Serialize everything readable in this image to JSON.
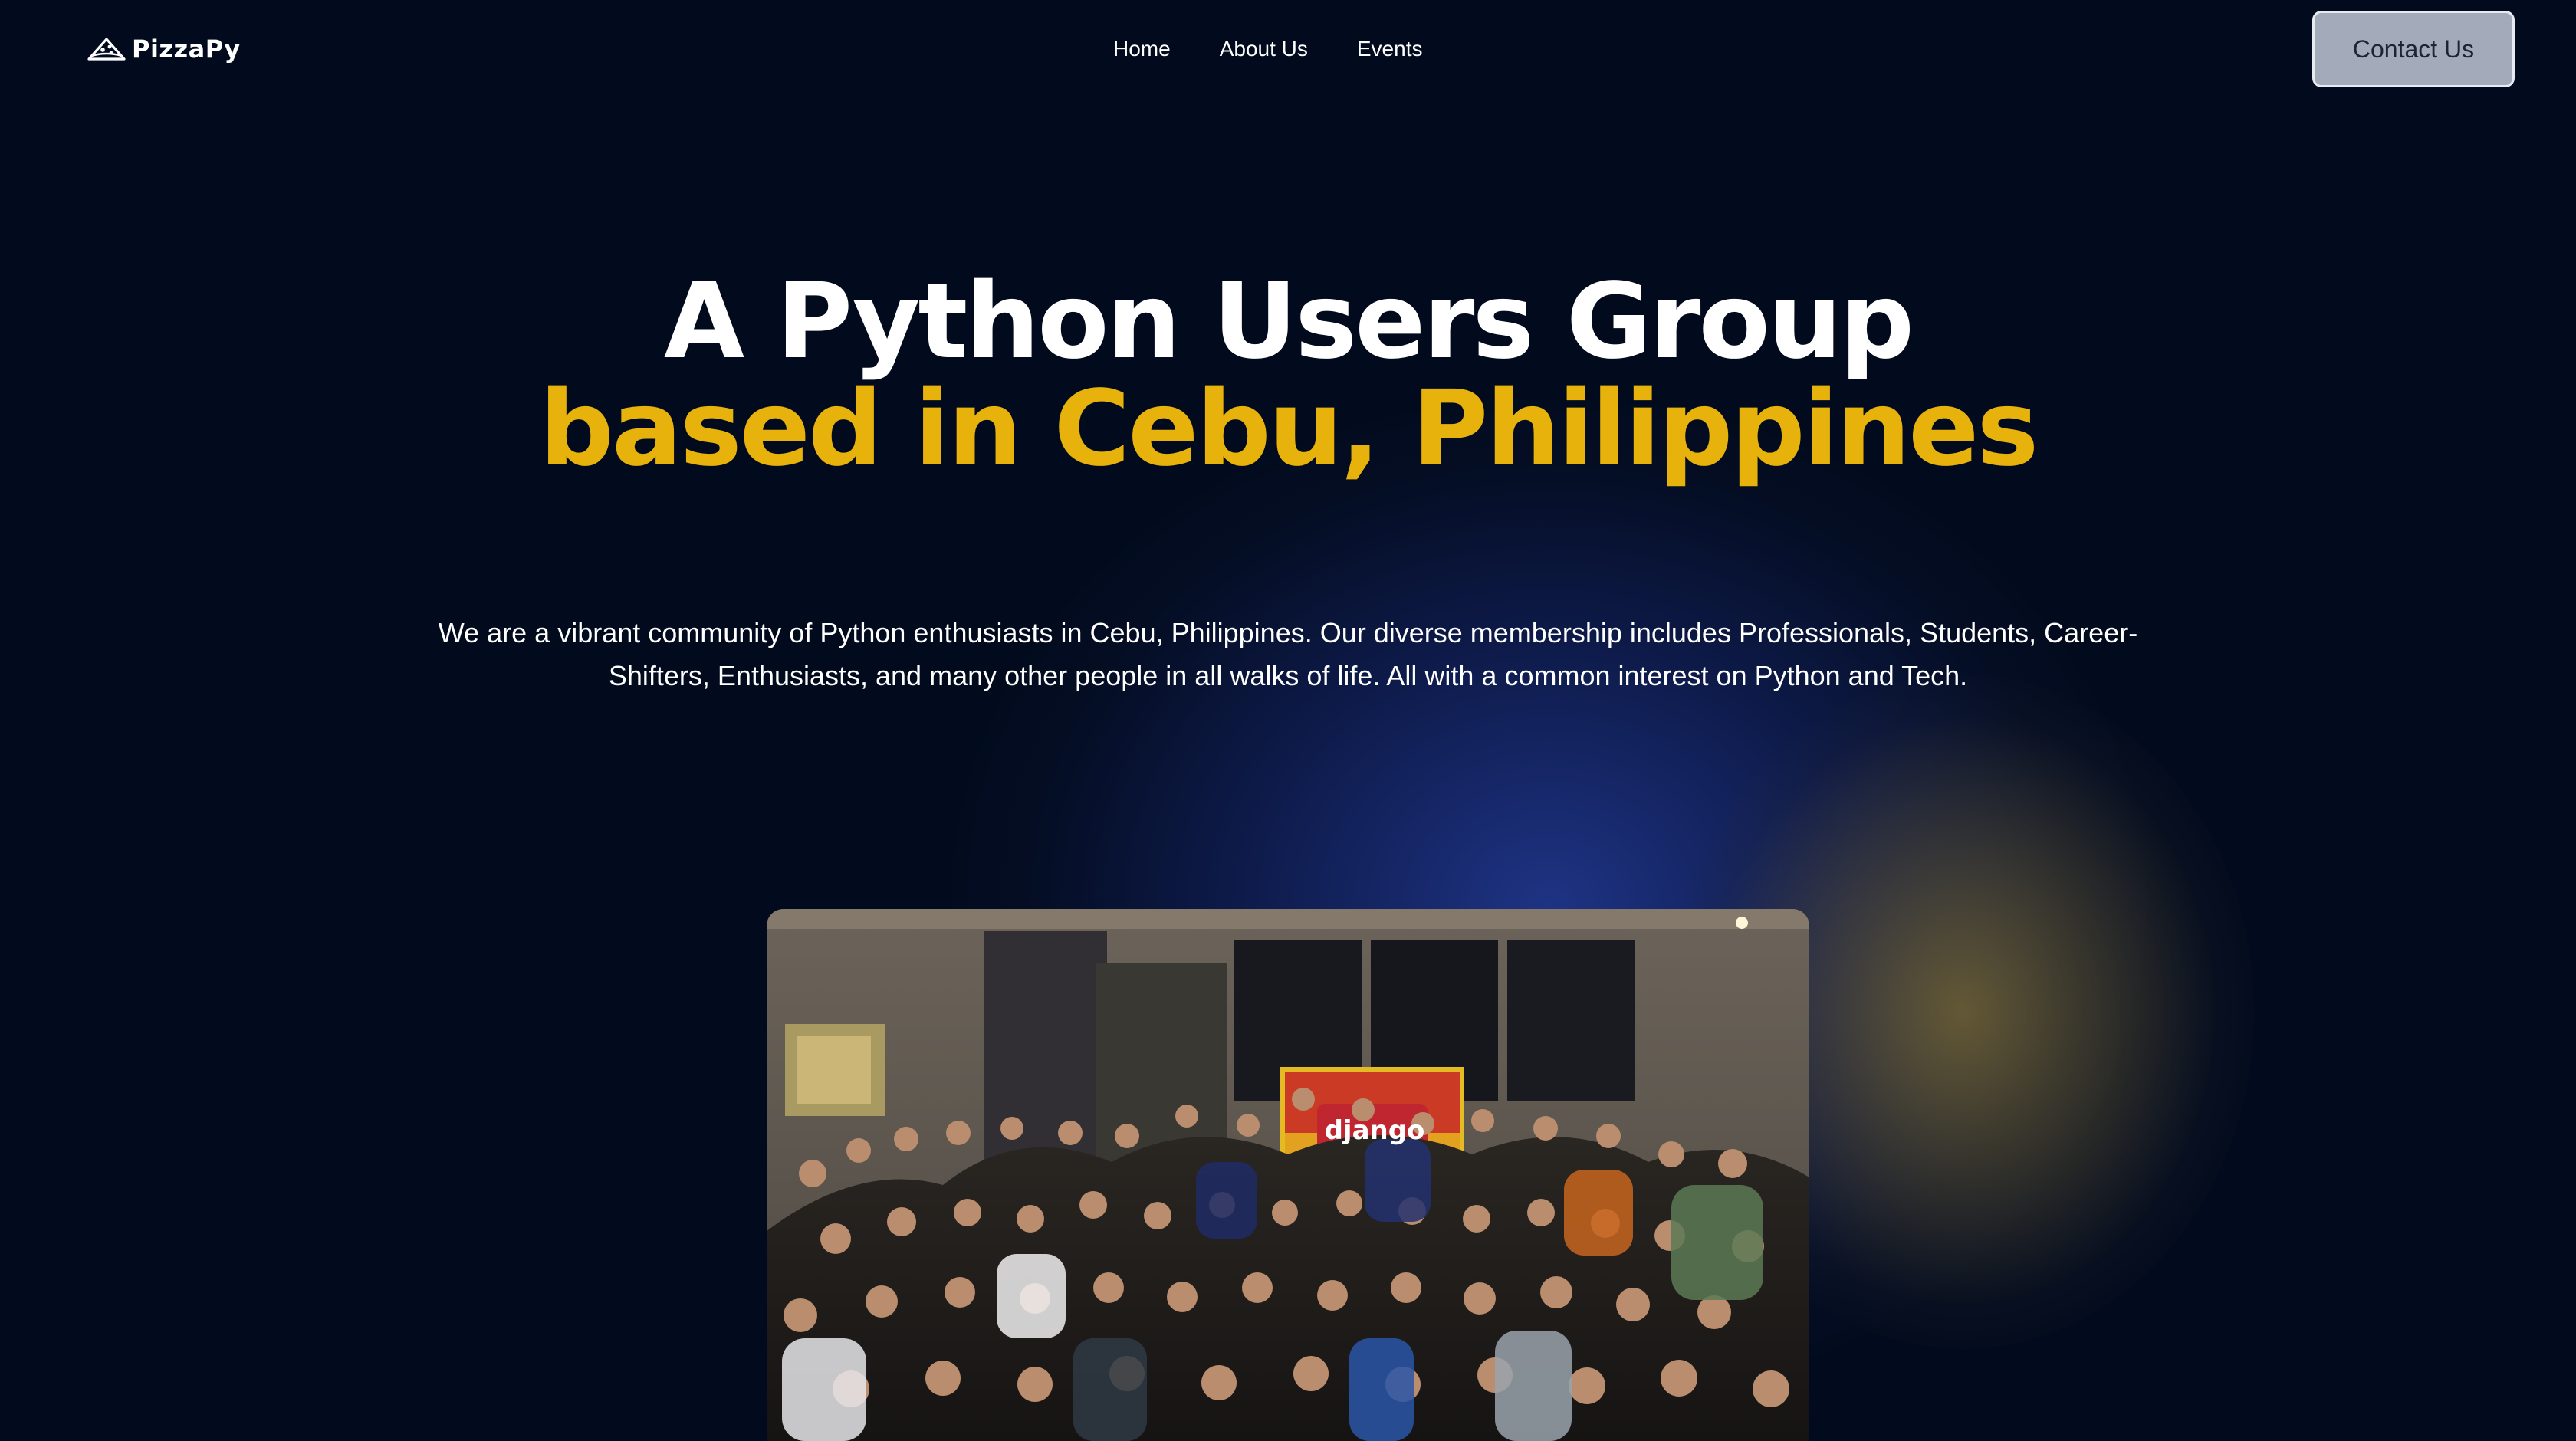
{
  "brand": {
    "name": "PizzaPy",
    "logo_icon": "pizza-slice-icon"
  },
  "nav": {
    "links": [
      {
        "label": "Home"
      },
      {
        "label": "About Us"
      },
      {
        "label": "Events"
      }
    ],
    "contact_label": "Contact Us"
  },
  "hero": {
    "title_line1": "A Python Users Group",
    "title_line2": "based in Cebu, Philippines",
    "description": "We are a vibrant community of Python enthusiasts in Cebu, Philippines. Our diverse membership includes Professionals, Students, Career-Shifters, Enthusiasts, and many other people in all walks of life. All with a common interest on Python and Tech."
  },
  "photo": {
    "screen_text": "django"
  },
  "colors": {
    "background": "#020b1d",
    "accent_gold": "#e8b20c",
    "text": "#ffffff",
    "button_bg": "#a3abba"
  }
}
